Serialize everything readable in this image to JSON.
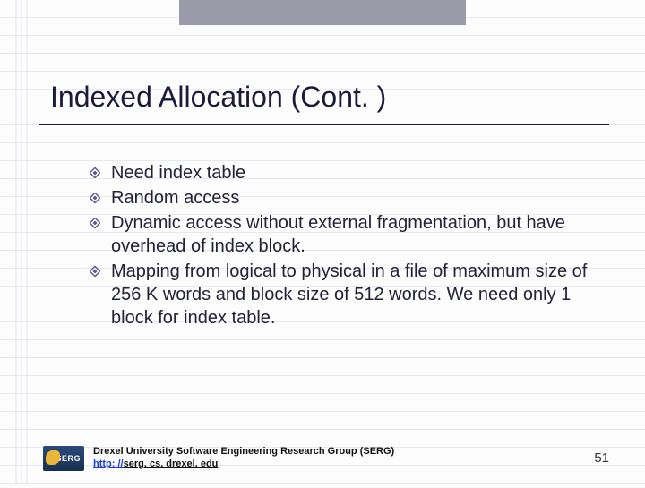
{
  "title": "Indexed Allocation (Cont. )",
  "bullets": [
    "Need index table",
    "Random access",
    "Dynamic access without external fragmentation, but have overhead of index block.",
    "Mapping from logical to physical in a file of maximum size of 256 K words and block size of 512 words.  We need only 1 block for index table."
  ],
  "footer": {
    "org": "Drexel University Software Engineering Research Group (SERG)",
    "url_scheme": "http: //",
    "url_host": "serg. cs. drexel. edu",
    "logo_label": "SERG"
  },
  "page_number": "51"
}
